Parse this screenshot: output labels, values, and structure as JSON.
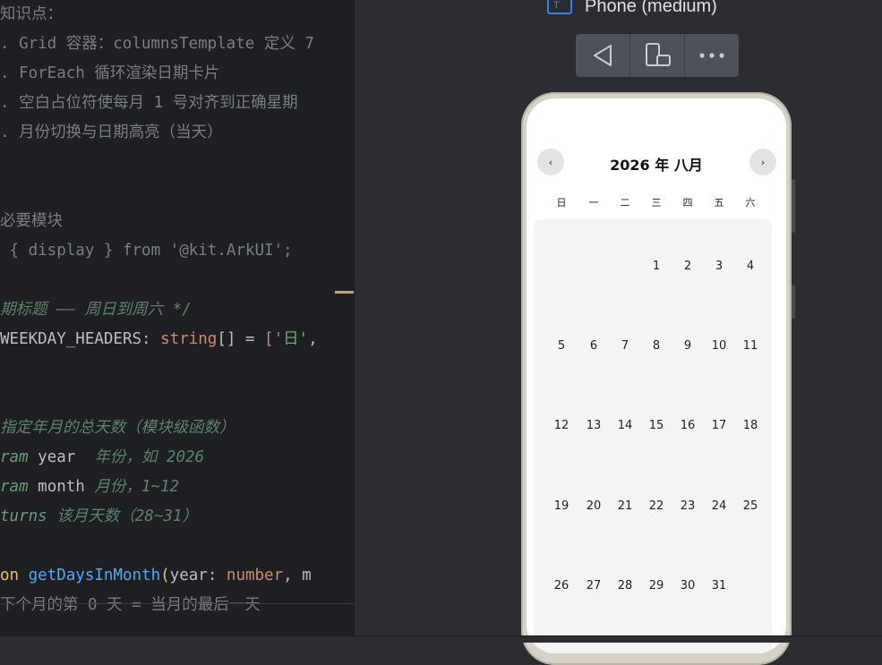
{
  "editor": {
    "lines": [
      [
        {
          "t": "知识点：",
          "c": "c-gray"
        }
      ],
      [
        {
          "t": ". Grid 容器：columnsTemplate 定义 7",
          "c": "c-gray"
        }
      ],
      [
        {
          "t": ". ForEach 循环渲染日期卡片",
          "c": "c-gray"
        }
      ],
      [
        {
          "t": ". 空白占位符使每月 1 号对齐到正确星期",
          "c": "c-gray"
        }
      ],
      [
        {
          "t": ". 月份切换与日期高亮（当天）",
          "c": "c-gray"
        }
      ],
      [],
      [],
      [
        {
          "t": "必要模块",
          "c": "c-gray"
        }
      ],
      [
        {
          "t": " { display } ",
          "c": "c-gray"
        },
        {
          "t": "from",
          "c": "c-gray"
        },
        {
          "t": " '@kit.ArkUI';",
          "c": "c-gray"
        }
      ],
      [],
      [
        {
          "t": "期标题 —— 周日到周六 */",
          "c": "c-com"
        }
      ],
      [
        {
          "t": "WEEKDAY_HEADERS",
          "c": "c-white"
        },
        {
          "t": ": ",
          "c": "c-white"
        },
        {
          "t": "string",
          "c": "c-kw"
        },
        {
          "t": "[]",
          "c": "c-white"
        },
        {
          "t": " = ",
          "c": "c-white"
        },
        {
          "t": "[",
          "c": "c-purple"
        },
        {
          "t": "'日'",
          "c": "c-str"
        },
        {
          "t": ",",
          "c": "c-white"
        }
      ],
      [],
      [],
      [
        {
          "t": "指定年月的总天数（模块级函数）",
          "c": "c-com"
        }
      ],
      [
        {
          "t": "ram ",
          "c": "c-param"
        },
        {
          "t": "year",
          "c": "c-white"
        },
        {
          "t": "  年份，如 2026",
          "c": "c-com"
        }
      ],
      [
        {
          "t": "ram ",
          "c": "c-param"
        },
        {
          "t": "month",
          "c": "c-white"
        },
        {
          "t": " 月份，1~12",
          "c": "c-com"
        }
      ],
      [
        {
          "t": "turns",
          "c": "c-param"
        },
        {
          "t": " 该月天数（28~31）",
          "c": "c-com"
        }
      ],
      [],
      [
        {
          "t": "on ",
          "c": "c-yellow"
        },
        {
          "t": "getDaysInMonth",
          "c": "c-fn"
        },
        {
          "t": "(",
          "c": "c-yellow"
        },
        {
          "t": "year",
          "c": "c-white"
        },
        {
          "t": ": ",
          "c": "c-white"
        },
        {
          "t": "number",
          "c": "c-kw"
        },
        {
          "t": ", m",
          "c": "c-white"
        }
      ],
      [
        {
          "t": "下个月的第 0 天 = 当月的最后一天",
          "c": "c-gray"
        }
      ]
    ]
  },
  "preview": {
    "device_title": "Phone (medium)",
    "device_icon_letter": "T",
    "toolbar": {
      "back": "back-icon",
      "rotate": "rotate-device-icon",
      "more": "more-icon"
    }
  },
  "calendar": {
    "title": "2026 年 八月",
    "prev": "‹",
    "next": "›",
    "weekdays": [
      "日",
      "一",
      "二",
      "三",
      "四",
      "五",
      "六"
    ],
    "leading_blanks": 3,
    "days_in_month": 31
  }
}
